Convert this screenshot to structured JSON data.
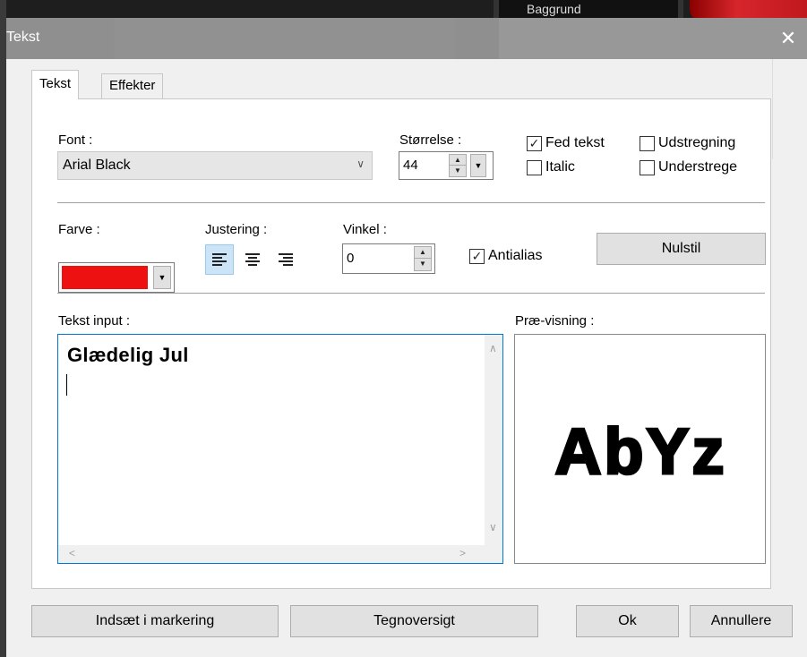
{
  "background": {
    "thumb_label": "Baggrund"
  },
  "dialog": {
    "title": "Tekst",
    "close_glyph": "✕"
  },
  "tabs": [
    {
      "label": "Tekst",
      "active": true
    },
    {
      "label": "Effekter",
      "active": false
    }
  ],
  "font": {
    "label": "Font :",
    "value": "Arial Black",
    "arrow": "∨"
  },
  "size": {
    "label": "Størrelse :",
    "value": "44"
  },
  "style_options": [
    {
      "label": "Fed tekst",
      "checked": true
    },
    {
      "label": "Udstregning",
      "checked": false
    },
    {
      "label": "Italic",
      "checked": false
    },
    {
      "label": "Understrege",
      "checked": false
    }
  ],
  "color": {
    "label": "Farve :",
    "value": "#ee1111"
  },
  "alignment": {
    "label": "Justering :",
    "options": [
      "left",
      "center",
      "right"
    ],
    "selected": "left"
  },
  "angle": {
    "label": "Vinkel :",
    "value": "0"
  },
  "antialias": {
    "label": "Antialias",
    "checked": true
  },
  "reset_button": "Nulstil",
  "text_input": {
    "label": "Tekst input :",
    "value": "Glædelig Jul"
  },
  "preview": {
    "label": "Præ-visning :",
    "sample": "AbYz"
  },
  "footer": {
    "insert_button": "Indsæt i markering",
    "charmap_button": "Tegnoversigt",
    "ok_button": "Ok",
    "cancel_button": "Annullere"
  },
  "check_glyph": "✓",
  "accent_color": "#0078d7"
}
